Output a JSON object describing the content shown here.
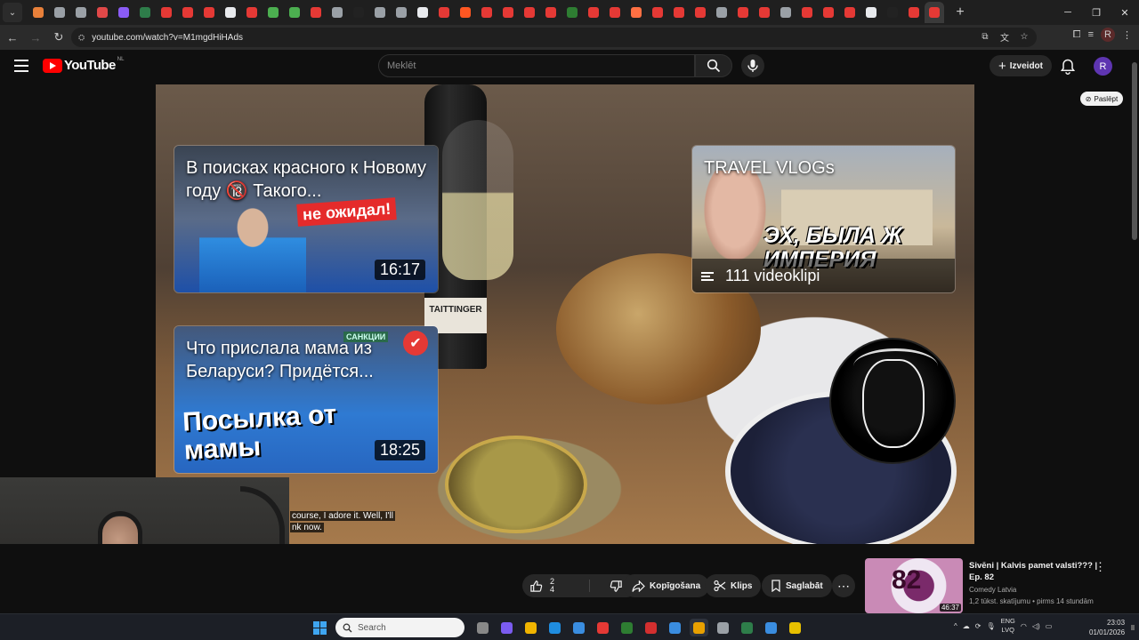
{
  "browser": {
    "url": "youtube.com/watch?v=M1mgdHiHAds",
    "tab_favicon_colors": [
      "#e8803a",
      "#9aa0a6",
      "#9aa0a6",
      "#e04848",
      "#8b5cf6",
      "#2e7d4a",
      "#e53935",
      "#e53935",
      "#e53935",
      "#e8eaed",
      "#e53935",
      "#4caf50",
      "#4caf50",
      "#e53935",
      "#9aa0a6",
      "#222",
      "#9aa0a6",
      "#9aa0a6",
      "#e8eaed",
      "#e53935",
      "#ff5722",
      "#e53935",
      "#e53935",
      "#e53935",
      "#e53935",
      "#2e7d32",
      "#e53935",
      "#e53935",
      "#ff7043",
      "#e53935",
      "#e53935",
      "#e53935",
      "#9aa0a6",
      "#e53935",
      "#e53935",
      "#9aa0a6",
      "#e53935",
      "#e53935",
      "#e53935",
      "#e8eaed",
      "#222",
      "#e53935",
      "#e53935"
    ]
  },
  "youtube": {
    "logo_text": "YouTube",
    "logo_region": "NL",
    "search_placeholder": "Meklēt",
    "create_label": "Izveidot",
    "avatar_letter": "R",
    "hide_label": "Paslēpt"
  },
  "player": {
    "bottle_label": "TAITTINGER",
    "captions": [
      "course, I adore it. Well, I'll",
      "nk now."
    ],
    "endcards": [
      {
        "title": "В поисках красного к Новому году 🔞 Такого...",
        "overlay": "не ожидал!",
        "duration": "16:17"
      },
      {
        "title": "Что прислала мама из Беларуси? Придётся...",
        "overlay": "Посылка от мамы",
        "badge": "САНКЦИИ",
        "duration": "18:25"
      },
      {
        "title": "TRAVEL VLOGs",
        "overlay": "ЭХ, БЫЛА Ж ИМПЕРИЯ",
        "playlist_count": "111 videoklipi"
      }
    ]
  },
  "actions": {
    "likes": "2",
    "likes_sub": "4",
    "share": "Kopīgošana",
    "clip": "Klips",
    "save": "Saglabāt",
    "more": "⋯"
  },
  "recommended": {
    "title": "Sivēni | Kalvis pamet valsti??? | Ep. 82",
    "channel": "Comedy Latvia",
    "meta": "1,2 tūkst. skatījumu • pirms 14 stundām",
    "duration": "46:37",
    "thumb_text": "82"
  },
  "taskbar": {
    "search_placeholder": "Search",
    "lang_top": "ENG",
    "lang_bottom": "LVQ",
    "time": "23:03",
    "date": "01/01/2026",
    "app_colors": [
      "#888",
      "#7b5cf0",
      "#f0b400",
      "#1f8de0",
      "#3a8de0",
      "#e53935",
      "#2e7d32",
      "#d32f2f",
      "#3a8de0",
      "#e8a000",
      "#9aa0a6",
      "#2e7d4a",
      "#3a8de0",
      "#e8c000"
    ]
  }
}
